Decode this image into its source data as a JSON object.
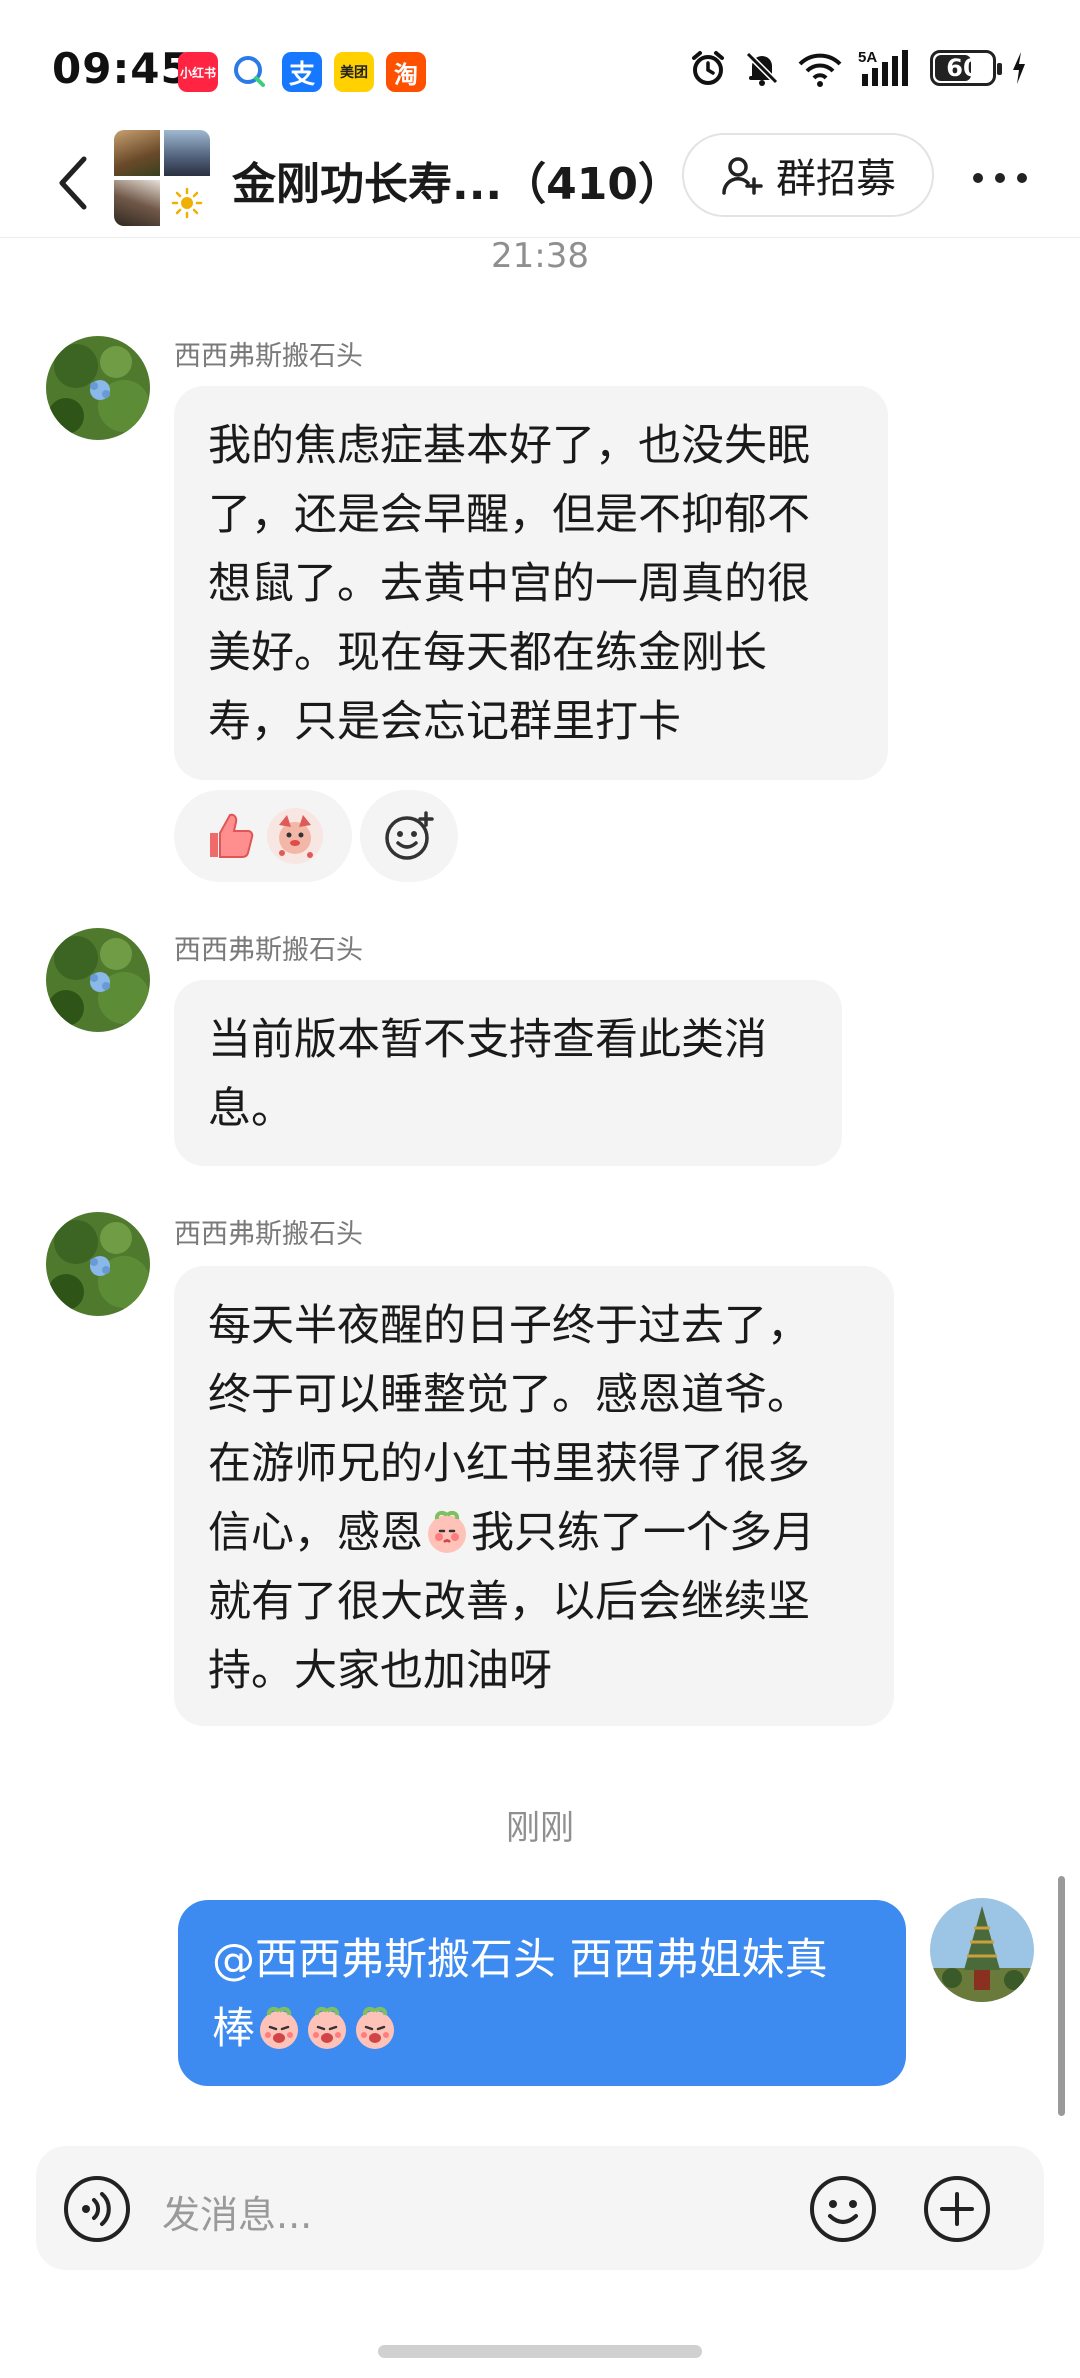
{
  "status_bar": {
    "time": "09:45",
    "app_icons": [
      {
        "name": "xiaohongshu-icon",
        "label": "小红书"
      },
      {
        "name": "chat-bubble-icon",
        "label": ""
      },
      {
        "name": "alipay-icon",
        "label": "支"
      },
      {
        "name": "meituan-icon",
        "label": "美团"
      },
      {
        "name": "taobao-icon",
        "label": "淘"
      }
    ],
    "network": "5A",
    "battery": "60",
    "battery_level": 0.6
  },
  "header": {
    "title": "金刚功长寿...（410）",
    "recruit_label": "群招募"
  },
  "messages": {
    "time_1": "21:38",
    "msg1": {
      "sender": "西西弗斯搬石头",
      "lines": [
        "我的焦虑症基本好了，也没失眠",
        "了，还是会早醒，但是不抑郁不",
        "想鼠了。去黄中宫的一周真的很",
        "美好。现在每天都在练金刚长",
        "寿，只是会忘记群里打卡"
      ]
    },
    "msg2": {
      "sender": "西西弗斯搬石头",
      "lines": [
        "当前版本暂不支持查看此类消",
        "息。"
      ]
    },
    "msg3": {
      "sender": "西西弗斯搬石头",
      "line1": "每天半夜醒的日子终于过去了，",
      "line2": "终于可以睡整觉了。感恩道爷。",
      "line3": "在游师兄的小红书里获得了很多",
      "line4a": "信心，感恩",
      "line4b": "我只练了一个多月",
      "line5": "就有了很大改善，以后会继续坚",
      "line6": "持。大家也加油呀"
    },
    "time_2": "刚刚",
    "my_msg": {
      "line1": "@西西弗斯搬石头 西西弗姐妹真",
      "line2": "棒"
    }
  },
  "input": {
    "placeholder": "发消息..."
  },
  "colors": {
    "accent_blue": "#3d8bf0",
    "incoming_bubble": "#f4f4f4"
  }
}
